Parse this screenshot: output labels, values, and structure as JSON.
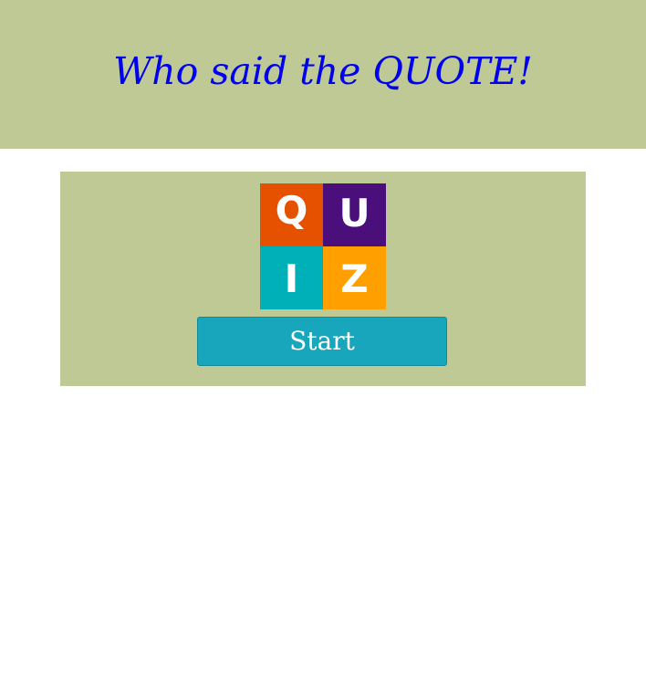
{
  "header": {
    "title": "Who said the QUOTE!"
  },
  "logo": {
    "letters": [
      "Q",
      "U",
      "I",
      "Z"
    ],
    "colors": {
      "q": "#e65100",
      "u": "#4a0f7a",
      "i": "#00b0b9",
      "z": "#ffa000"
    }
  },
  "start": {
    "label": "Start"
  },
  "colors": {
    "background_band": "#bec995",
    "title_text": "#0000ee",
    "button": "#17a6bb"
  }
}
